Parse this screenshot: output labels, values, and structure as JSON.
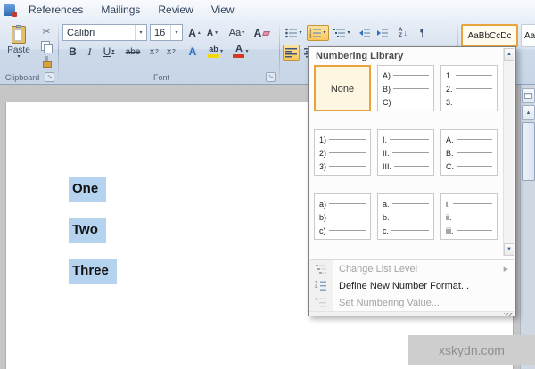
{
  "tabs": {
    "items": [
      "References",
      "Mailings",
      "Review",
      "View"
    ]
  },
  "ribbon": {
    "clipboard": {
      "paste": "Paste",
      "label": "Clipboard"
    },
    "font": {
      "family": "Calibri",
      "size": "16",
      "label": "Font",
      "grow": "A",
      "shrink": "A",
      "case": "Aa",
      "clear": "A",
      "bold": "B",
      "italic": "I",
      "underline": "U",
      "strike": "abe",
      "sub_x": "x",
      "sub_n": "2",
      "sup_x": "x",
      "sup_n": "2",
      "effects": "A",
      "highlight": "ab",
      "color": "A"
    },
    "paragraph": {
      "sort_a": "A",
      "sort_z": "Z"
    },
    "styles": {
      "style1": "AaBbCcDc",
      "style2": "AaBbCcDc"
    }
  },
  "icons": {
    "caret_down": "▾",
    "scroll_up": "▲",
    "scroll_down": "▼",
    "submenu": "▶",
    "cut": "✂",
    "launcher": "↘",
    "sort_down": "↓",
    "pilcrow": "¶"
  },
  "numbering": {
    "title": "Numbering Library",
    "none": "None",
    "cells": [
      {
        "items": [
          "A)",
          "B)",
          "C)"
        ]
      },
      {
        "items": [
          "1.",
          "2.",
          "3."
        ]
      },
      {
        "items": [
          "1)",
          "2)",
          "3)"
        ]
      },
      {
        "items": [
          "I.",
          "II.",
          "III."
        ]
      },
      {
        "items": [
          "A.",
          "B.",
          "C."
        ]
      },
      {
        "items": [
          "a)",
          "b)",
          "c)"
        ]
      },
      {
        "items": [
          "a.",
          "b.",
          "c."
        ]
      },
      {
        "items": [
          "i.",
          "ii.",
          "iii."
        ]
      }
    ],
    "menu": [
      {
        "label": "Change List Level",
        "disabled": true,
        "has_submenu": true
      },
      {
        "label": "Define New Number Format...",
        "disabled": false
      },
      {
        "label": "Set Numbering Value...",
        "disabled": true
      }
    ]
  },
  "document": {
    "lines": [
      "One",
      "Two",
      "Three"
    ]
  },
  "watermark": "xskydn.com",
  "colors": {
    "accent_orange": "#e8a33d",
    "selection_blue": "#b5d2ee"
  }
}
